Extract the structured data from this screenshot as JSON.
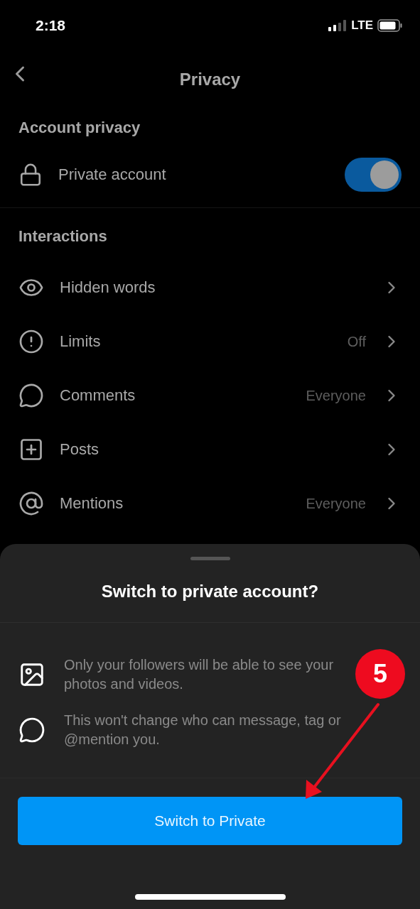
{
  "status_bar": {
    "time": "2:18",
    "network": "LTE"
  },
  "header": {
    "title": "Privacy"
  },
  "account_privacy": {
    "heading": "Account privacy",
    "private_account": {
      "label": "Private account",
      "on": true
    }
  },
  "interactions": {
    "heading": "Interactions",
    "items": [
      {
        "label": "Hidden words"
      },
      {
        "label": "Limits",
        "value": "Off"
      },
      {
        "label": "Comments",
        "value": "Everyone"
      },
      {
        "label": "Posts"
      },
      {
        "label": "Mentions",
        "value": "Everyone"
      }
    ]
  },
  "sheet": {
    "title": "Switch to private account?",
    "notes": [
      {
        "text": "Only your followers will be able to see your photos and videos."
      },
      {
        "text": "This won't change who can message, tag or @mention you."
      }
    ],
    "button": "Switch to Private"
  },
  "annotation": {
    "step": "5"
  }
}
